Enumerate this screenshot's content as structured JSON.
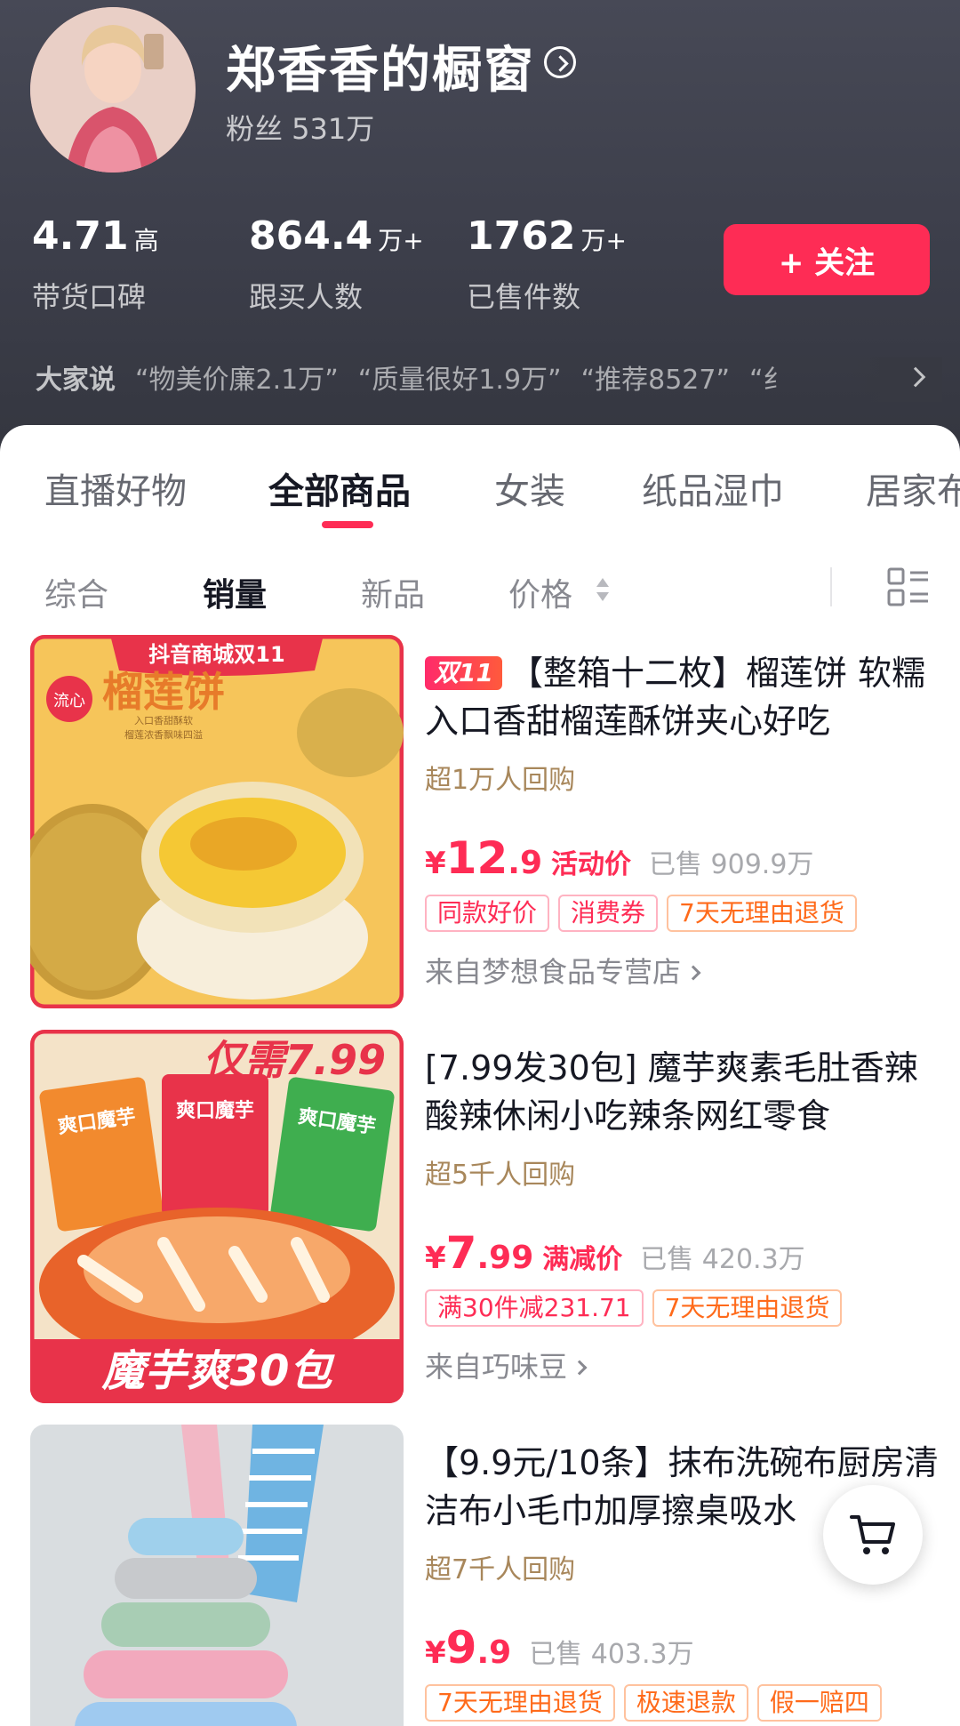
{
  "shop": {
    "name": "郑香香的橱窗",
    "fans": "粉丝 531万"
  },
  "stats": [
    {
      "value": "4.71",
      "unit": "高",
      "label": "带货口碑"
    },
    {
      "value": "864.4",
      "unit": "万+",
      "label": "跟买人数"
    },
    {
      "value": "1762",
      "unit": "万+",
      "label": "已售件数"
    }
  ],
  "follow_label": "+ 关注",
  "reviews": {
    "title": "大家说",
    "tags": [
      "“物美价廉2.1万”",
      "“质量很好1.9万”",
      "“推荐8527”",
      "“纟"
    ]
  },
  "category_tabs": [
    "直播好物",
    "全部商品",
    "女装",
    "纸品湿巾",
    "居家布"
  ],
  "active_category": "全部商品",
  "sort_options": [
    "综合",
    "销量",
    "新品",
    "价格"
  ],
  "active_sort": "销量",
  "products": [
    {
      "badge": "双11",
      "title": "【整箱十二枚】榴莲饼 软糯入口香甜榴莲酥饼夹心好吃",
      "rebuy": "超1万人回购",
      "price_symbol": "¥",
      "price_int": "12",
      "price_dec": ".9",
      "price_type": "活动价",
      "sold": "已售 909.9万",
      "tags": [
        "同款好价",
        "消费券",
        "7天无理由退货"
      ],
      "store": "来自梦想食品专营店",
      "image_text": {
        "banner": "抖音商城双11",
        "side": "流心",
        "name": "榴莲饼",
        "sub1": "入口香甜酥软",
        "sub2": "榴莲浓香飘味四溢"
      }
    },
    {
      "badge": "",
      "title": "[7.99发30包] 魔芋爽素毛肚香辣酸辣休闲小吃辣条网红零食",
      "rebuy": "超5千人回购",
      "price_symbol": "¥",
      "price_int": "7",
      "price_dec": ".99",
      "price_type": "满减价",
      "sold": "已售 420.3万",
      "tags": [
        "满30件减231.71",
        "7天无理由退货"
      ],
      "store": "来自巧味豆",
      "image_text": {
        "top": "仅需7.99",
        "pack": "爽口魔芋",
        "bottom": "魔芋爽30包"
      }
    },
    {
      "badge": "",
      "title": "【9.9元/10条】抹布洗碗布厨房清洁布小毛巾加厚擦桌吸水",
      "rebuy": "超7千人回购",
      "price_symbol": "¥",
      "price_int": "9",
      "price_dec": ".9",
      "price_type": "",
      "sold": "已售 403.3万",
      "tags": [
        "7天无理由退货",
        "极速退款",
        "假一赔四"
      ],
      "store": "",
      "image_text": {}
    }
  ],
  "colors": {
    "accent": "#fe2c55",
    "header_bg": "#3f414d",
    "rebuy": "#a8875b",
    "orange_tag": "#ff6a1a"
  },
  "icons": [
    "chevron-right-circle-icon",
    "chevron-right-icon",
    "sort-arrows-icon",
    "list-layout-icon",
    "cart-icon"
  ]
}
